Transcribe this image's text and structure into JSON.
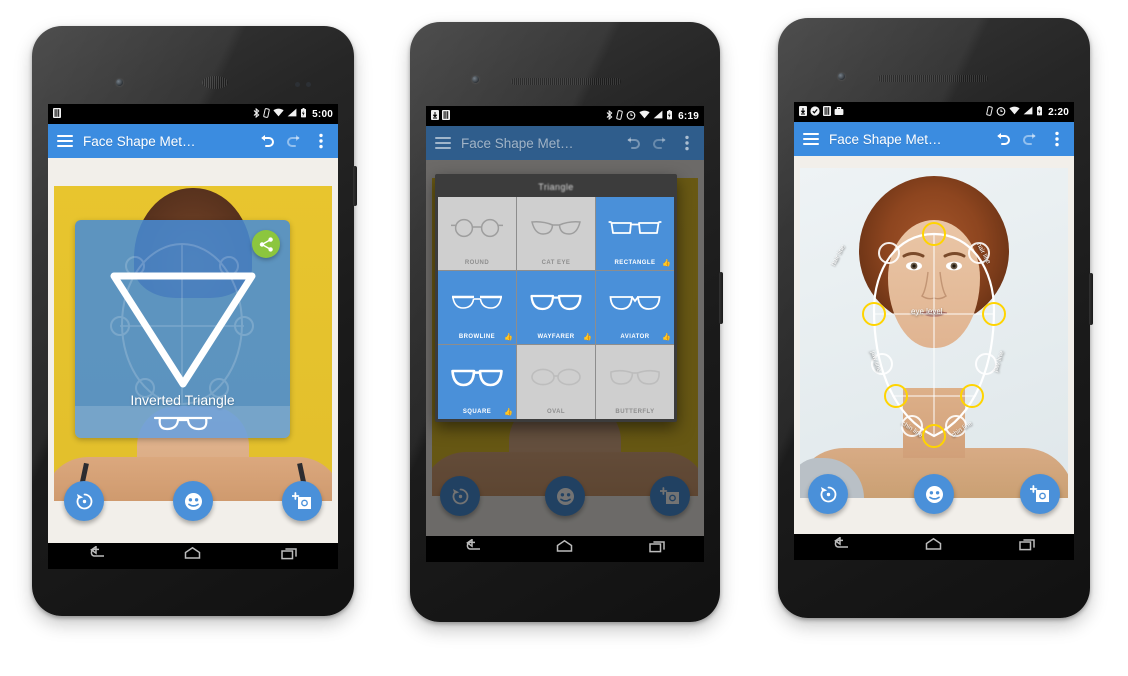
{
  "app": {
    "title": "Face Shape Met…",
    "brand_color": "#3b8ce0",
    "fab_color": "#4a90d9",
    "share_color": "#8cc63e"
  },
  "phones": [
    {
      "id": "phone-left",
      "device": "nexus-5",
      "status": {
        "time": "5:00",
        "left_icons": [
          "sim-card-icon"
        ],
        "right_icons": [
          "bluetooth-icon",
          "vibrate-icon",
          "wifi-icon",
          "signal-icon",
          "battery-icon"
        ]
      },
      "appbar": {
        "menu": "hamburger-icon",
        "title": "Face Shape Met…",
        "undo": "undo-icon",
        "redo": "redo-icon",
        "overflow": "overflow-menu-icon"
      },
      "dimmed": false,
      "result": {
        "shape_label": "Inverted Triangle",
        "share": "share-icon",
        "glasses": "glasses-icon"
      },
      "fabs": [
        {
          "name": "reset-fab",
          "icon": "restore-icon"
        },
        {
          "name": "detect-face-fab",
          "icon": "face-icon"
        },
        {
          "name": "add-photo-fab",
          "icon": "add-photo-icon"
        }
      ],
      "nav": [
        "back-button",
        "home-button",
        "recents-button"
      ]
    },
    {
      "id": "phone-center",
      "device": "generic-android",
      "status": {
        "time": "6:19",
        "left_icons": [
          "download-icon",
          "sim-card-icon"
        ],
        "right_icons": [
          "bluetooth-icon",
          "vibrate-icon",
          "alarm-icon",
          "wifi-icon",
          "signal-icon",
          "battery-icon"
        ]
      },
      "appbar": {
        "menu": "hamburger-icon",
        "title": "Face Shape Met…",
        "undo": "undo-icon",
        "redo": "redo-icon",
        "overflow": "overflow-menu-icon"
      },
      "dimmed": true,
      "fabs": [
        {
          "name": "reset-fab",
          "icon": "restore-icon"
        },
        {
          "name": "detect-face-fab",
          "icon": "face-icon"
        },
        {
          "name": "add-photo-fab",
          "icon": "add-photo-icon"
        }
      ],
      "nav": [
        "back-button",
        "home-button",
        "recents-button"
      ]
    },
    {
      "id": "phone-right",
      "device": "generic-android",
      "status": {
        "time": "2:20",
        "left_icons": [
          "download-icon",
          "check-circle-icon",
          "sim-card-icon",
          "briefcase-icon"
        ],
        "right_icons": [
          "vibrate-icon",
          "alarm-icon",
          "wifi-icon",
          "signal-icon",
          "battery-icon"
        ]
      },
      "appbar": {
        "menu": "hamburger-icon",
        "title": "Face Shape Met…",
        "undo": "undo-icon",
        "redo": "redo-icon",
        "overflow": "overflow-menu-icon"
      },
      "dimmed": false,
      "fabs": [
        {
          "name": "reset-fab",
          "icon": "restore-icon"
        },
        {
          "name": "detect-face-fab",
          "icon": "face-icon"
        },
        {
          "name": "add-photo-fab",
          "icon": "add-photo-icon"
        }
      ],
      "nav": [
        "back-button",
        "home-button",
        "recents-button"
      ]
    }
  ],
  "glasses_dialog": {
    "title": "Triangle",
    "items": [
      {
        "label": "ROUND",
        "shape": "round",
        "recommended": false
      },
      {
        "label": "CAT EYE",
        "shape": "cat-eye",
        "recommended": false
      },
      {
        "label": "RECTANGLE",
        "shape": "rectangle",
        "recommended": true
      },
      {
        "label": "BROWLINE",
        "shape": "browline",
        "recommended": true
      },
      {
        "label": "WAYFARER",
        "shape": "wayfarer",
        "recommended": true
      },
      {
        "label": "AVIATOR",
        "shape": "aviator",
        "recommended": true
      },
      {
        "label": "SQUARE",
        "shape": "square",
        "recommended": true
      },
      {
        "label": "OVAL",
        "shape": "oval",
        "recommended": false
      },
      {
        "label": "BUTTERFLY",
        "shape": "butterfly",
        "recommended": false
      }
    ],
    "thumb_glyph": "👍",
    "selected_color": "#4a90d9",
    "unselected_color": "#cfcfcf"
  },
  "face_overlay": {
    "labels": {
      "hair_line_left": "hair line",
      "hair_line_right": "hair line",
      "eye_level": "eye level",
      "jaw_line_left": "jaw line",
      "jaw_line_right": "jaw line",
      "chin_line_left": "chin line",
      "chin_line_right": "chin line"
    },
    "node_color": "#ffd400",
    "outline_color": "#ffffff"
  }
}
